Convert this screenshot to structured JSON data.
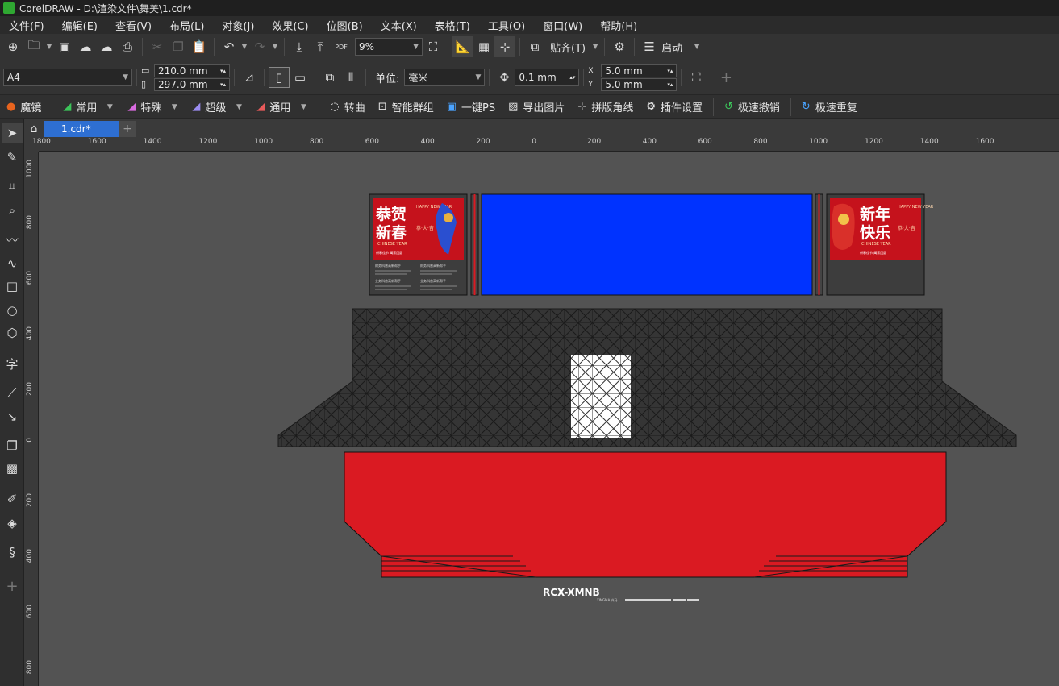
{
  "window": {
    "title": "CorelDRAW - D:\\渲染文件\\舞美\\1.cdr*"
  },
  "menu": [
    "文件(F)",
    "编辑(E)",
    "查看(V)",
    "布局(L)",
    "对象(J)",
    "效果(C)",
    "位图(B)",
    "文本(X)",
    "表格(T)",
    "工具(O)",
    "窗口(W)",
    "帮助(H)"
  ],
  "toolbar": {
    "zoom": "9%",
    "snap_label": "贴齐(T)",
    "launch_label": "启动",
    "pdf_label": "PDF"
  },
  "property_bar": {
    "page_size": "A4",
    "width": "210.0 mm",
    "height": "297.0 mm",
    "units_label": "单位:",
    "units_value": "毫米",
    "nudge": "0.1 mm",
    "dup_x": "5.0 mm",
    "dup_y": "5.0 mm",
    "dup_x_label": "X",
    "dup_y_label": "Y"
  },
  "plugin_bar": [
    {
      "label": "魔镜",
      "icon": "magic-mirror-icon",
      "color": "#e8641e",
      "dropdown": false
    },
    {
      "label": "常用",
      "icon": "arrow-green-icon",
      "color": "#3cc45a",
      "dropdown": true
    },
    {
      "label": "特殊",
      "icon": "arrow-pink-icon",
      "color": "#d86adf",
      "dropdown": true
    },
    {
      "label": "超级",
      "icon": "arrow-purple-icon",
      "color": "#9a8cf0",
      "dropdown": true
    },
    {
      "label": "通用",
      "icon": "arrow-red-icon",
      "color": "#e85a5a",
      "dropdown": true
    },
    {
      "label": "转曲",
      "icon": "convert-curve-icon",
      "color": "#dddddd",
      "dropdown": false
    },
    {
      "label": "智能群组",
      "icon": "smart-group-icon",
      "color": "#dddddd",
      "dropdown": false
    },
    {
      "label": "一键PS",
      "icon": "photoshop-icon",
      "color": "#4aa3ff",
      "dropdown": false
    },
    {
      "label": "导出图片",
      "icon": "export-image-icon",
      "color": "#dddddd",
      "dropdown": false
    },
    {
      "label": "拼版角线",
      "icon": "crop-marks-icon",
      "color": "#dddddd",
      "dropdown": false
    },
    {
      "label": "插件设置",
      "icon": "gear-icon",
      "color": "#dddddd",
      "dropdown": false
    },
    {
      "label": "极速撤销",
      "icon": "undo-green-icon",
      "color": "#3cc45a",
      "dropdown": false
    },
    {
      "label": "极速重复",
      "icon": "redo-blue-icon",
      "color": "#4aa3ff",
      "dropdown": false
    }
  ],
  "tabs": {
    "document": "1.cdr*",
    "add": "+"
  },
  "rulers": {
    "horizontal": [
      "1800",
      "1600",
      "1400",
      "1200",
      "1000",
      "800",
      "600",
      "400",
      "200",
      "0",
      "200",
      "400",
      "600",
      "800",
      "1000",
      "1200",
      "1400",
      "1600"
    ],
    "vertical": [
      "1000",
      "800",
      "600",
      "400",
      "200",
      "0",
      "200",
      "400",
      "600",
      "800"
    ]
  },
  "artwork": {
    "colors": {
      "screen": "#0033ff",
      "skirt": "#da1a22",
      "truss_bg": "#2c2c2c",
      "panel": "#3d3d3d",
      "poster_red": "#c5121c"
    },
    "poster_left": {
      "headline": "恭贺新春",
      "en": "HAPPY NEW YEAR",
      "sub": "CHINESE YEAR",
      "side": "恭·大·吉",
      "footer": "新春佳节 阖家团圆"
    },
    "poster_right": {
      "headline": "新年快乐",
      "en": "HAPPY NEW YEAR",
      "sub": "CHINESE YEAR",
      "side": "恭·大·吉",
      "footer": "新春佳节 阖家团圆"
    },
    "panel_left_text": [
      "财务科普高新帮手",
      "财务科普高新帮手",
      "业务科普高新帮手",
      "业务科普高新帮手"
    ],
    "model_name": "RCX-XMNB",
    "brand": "XINGMA 兴马"
  }
}
